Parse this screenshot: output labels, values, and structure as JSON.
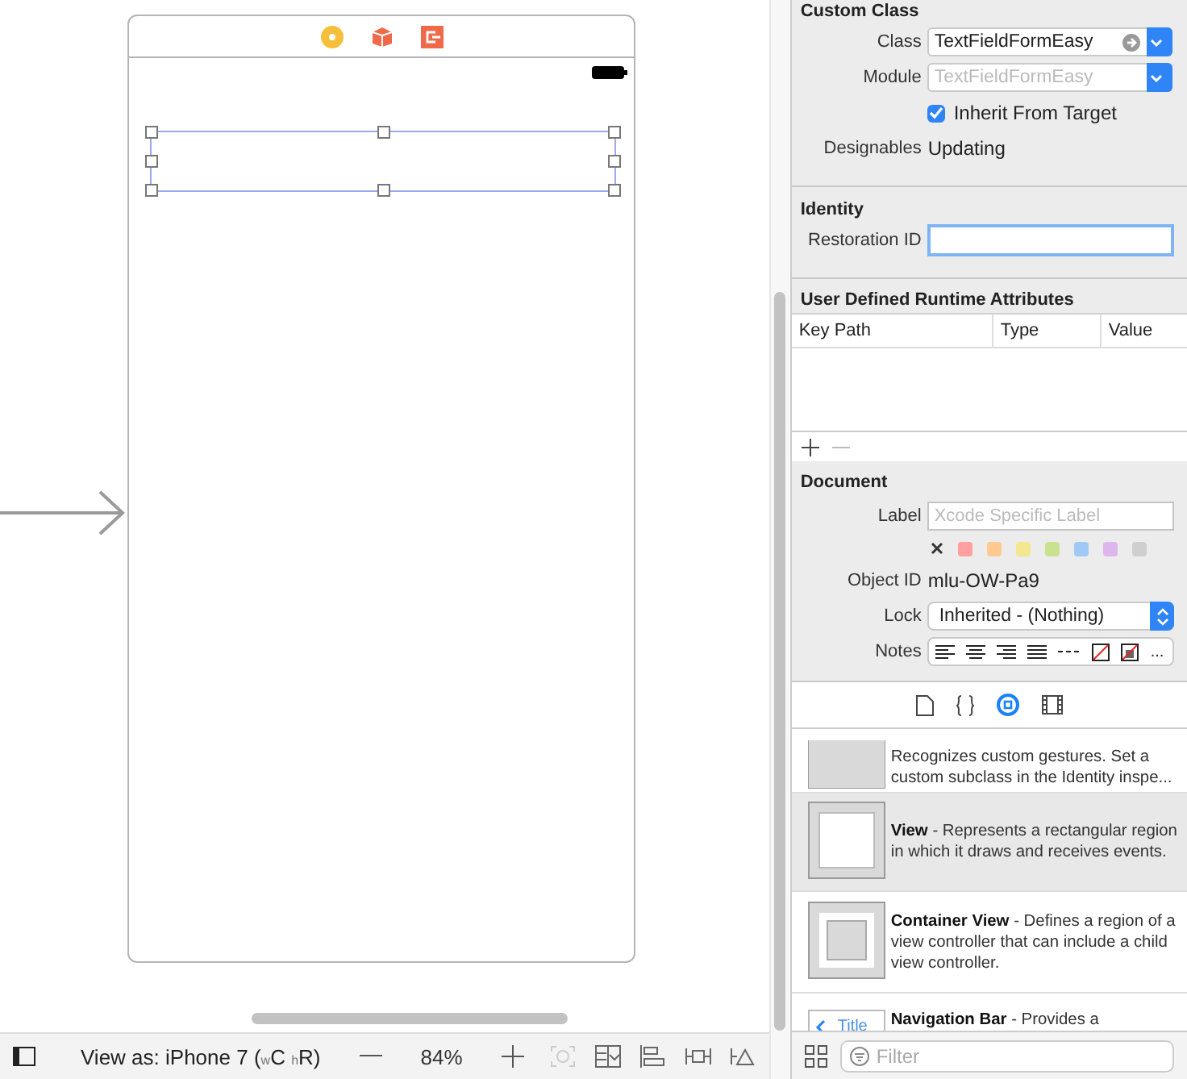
{
  "canvas": {
    "text_field": {
      "selected": true
    }
  },
  "bottom_bar": {
    "view_as": "View as: iPhone 7 ($_{w}$C $_{h}$R)",
    "zoom": "84%"
  },
  "custom_class": {
    "title": "Custom Class",
    "class_label": "Class",
    "class_value": "TextFieldFormEasy",
    "module_label": "Module",
    "module_placeholder": "TextFieldFormEasy",
    "inherit": {
      "label": "Inherit From Target",
      "checked": true
    },
    "designables_label": "Designables",
    "designables_value": "Updating"
  },
  "identity": {
    "title": "Identity",
    "restoration_label": "Restoration ID",
    "focused": true
  },
  "runtime_attributes": {
    "title": "User Defined Runtime Attributes",
    "columns": [
      "Key Path",
      "Type",
      "Value"
    ]
  },
  "document": {
    "title": "Document",
    "label_label": "Label",
    "label_placeholder": "Xcode Specific Label",
    "colors": [
      {
        "color": "#ff9f9f"
      },
      {
        "color": "#ffc98f"
      },
      {
        "color": "#f3e88f"
      },
      {
        "color": "#c9e28f"
      },
      {
        "color": "#9fcaf5"
      },
      {
        "color": "#dcb6ec"
      },
      {
        "color": "#cfcfcf"
      }
    ],
    "object_id_label": "Object ID",
    "object_id_value": "mlu-OW-Pa9",
    "lock_label": "Lock",
    "lock_value": "Inherited - (Nothing)",
    "notes_label": "Notes",
    "notes_more": "..."
  },
  "inspector_tabs": [
    {
      "kind": "file",
      "selected": false
    },
    {
      "kind": "code",
      "selected": false
    },
    {
      "kind": "object",
      "selected": true
    },
    {
      "kind": "media",
      "selected": false
    }
  ],
  "library": [
    {
      "kind": "gesture",
      "description": "Recognizes custom gestures. Set a custom subclass in the Identity inspe...",
      "selected": false
    },
    {
      "kind": "view",
      "title": "View",
      "description": " - Represents a rectangular region in which it draws and receives events.",
      "selected": true
    },
    {
      "kind": "container",
      "title": "Container View",
      "description": " - Defines a region of a view controller that can include a child view controller.",
      "selected": false
    },
    {
      "kind": "navbar",
      "title": "Navigation Bar",
      "description": " - Provides a",
      "thumb_label": "Title",
      "selected": false
    }
  ],
  "filter": {
    "placeholder": "Filter"
  }
}
